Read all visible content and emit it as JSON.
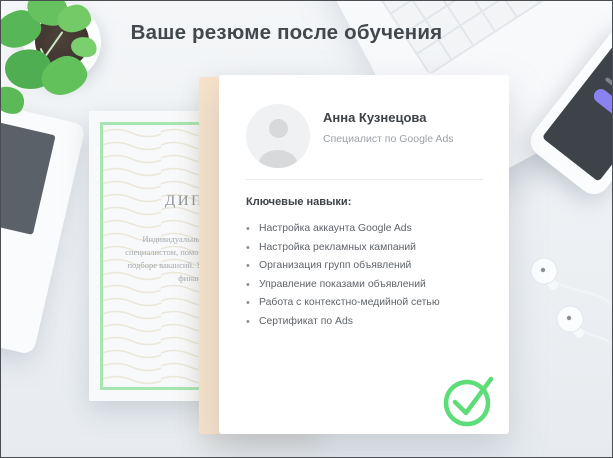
{
  "page": {
    "title": "Ваше резюме после обучения"
  },
  "resume": {
    "name": "Анна Кузнецова",
    "role": "Специалист по Google Ads",
    "skills_header": "Ключевые навыки:",
    "bullet": "•",
    "skills": [
      "Настройка аккаунта Google Ads",
      "Настройка рекламных кампаний",
      "Организация групп объявлений",
      "Управление показами объявлений",
      "Работа с контекстно-медийной сетью",
      "Сертификат по Ads"
    ]
  },
  "diploma": {
    "title": "ДИПЛОМ",
    "lines": [
      "Индивидуальные",
      "специалистом, помощ",
      "подборе вакансий. Ус",
      "финанс"
    ]
  },
  "colors": {
    "accent_green": "#5edc78",
    "diploma_border": "#a7e6b1",
    "backing_peach": "#f8e2ca",
    "title_text": "#43484d"
  }
}
